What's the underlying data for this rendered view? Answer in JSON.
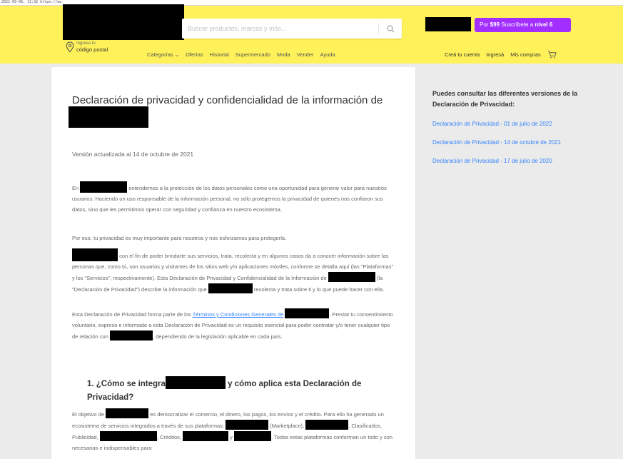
{
  "browser": {
    "address_text": "2022-09-06, 11:32 https://ww"
  },
  "header": {
    "search_placeholder": "Buscar productos, marcas y más...",
    "promo_prefix": "Por ",
    "promo_price": "$99",
    "promo_mid": " Suscríbete a ",
    "promo_level": "nivel 6",
    "location_small": "Ingresa tu",
    "location_big": "código postal",
    "nav": [
      "Categorías ⌄",
      "Ofertas",
      "Historial",
      "Supermercado",
      "Moda",
      "Vender",
      "Ayuda"
    ],
    "account": {
      "create": "Creá tu cuenta",
      "login": "Ingresá",
      "purchases": "Mis compras"
    }
  },
  "document": {
    "title": "Declaración de privacidad y confidencialidad de la información de",
    "version": "Versión actualizada al 14 de octubre de 2021",
    "p1_a": "En ",
    "p1_b": " entendemos a la protección de los datos personales como una oportunidad para generar valor para nuestros usuarios. Haciendo un uso responsable de la información personal, no sólo protegemos la privacidad de quienes nos confiaron sus datos, sino que les permitimos operar con seguridad y confianza en nuestro ecosistema.",
    "p2": "Por eso, tu privacidad es muy importante para nosotros y nos esforzamos para protegerla.",
    "p3_a": " con el fin de poder brindarte sus servicios, trata, recolecta y en algunos casos da a conocer información sobre las personas que, como tú, son usuarios y visitantes de los sitios web y/o aplicaciones móviles, conforme se detalla aquí (las \"Plataformas\" y los \"Servicios\", respectivamente). Esta Declaración de Privacidad y Confidencialidad de la Información de ",
    "p3_b": " (la \"Declaración de Privacidad\") describe la información que ",
    "p3_c": " recolecta y trata sobre ti y lo que puede hacer con ella.",
    "p4_a": "Esta Declaración de Privacidad forma parte de los ",
    "p4_link": "Términos y Condiciones Generales de",
    "p4_b": ". Prestar tu consentimiento voluntario, expreso e informado a esta Declaración de Privacidad es un requisito esencial para poder contratar y/o tener cualquier tipo de relación con ",
    "p4_c": ", dependiendo de la legislación aplicable en cada país.",
    "section1_a": "1. ¿Cómo se integra",
    "section1_b": " y cómo aplica esta Declaración de Privacidad?",
    "p5_a": "El objetivo de ",
    "p5_b": " es democratizar el comercio, el dinero, los pagos, los envíos y el crédito. Para ello ha generado un ecosistema de servicios integrados a través de sus plataformas: ",
    "p5_c": " (Marketplace), ",
    "p5_d": ", Clasificados, Publicidad, ",
    "p5_e": ", Créditos, ",
    "p5_f": " y ",
    "p5_g": ". Todas estas plataformas conforman un todo y son necesarias e indispensables para"
  },
  "sidebar": {
    "title": "Puedes consultar las diferentes versiones de la Declaración de Privacidad:",
    "links": [
      "Declaración de Privacidad - 01 de julio de 2022",
      "Declaración de Privacidad - 14 de octubre de 2021",
      "Declaración de Privacidad - 17 de julio de 2020"
    ]
  },
  "colors": {
    "header_bg": "#fff159",
    "promo_bg": "#a22eff",
    "link": "#3483fa",
    "page_bg": "#ebebeb"
  }
}
